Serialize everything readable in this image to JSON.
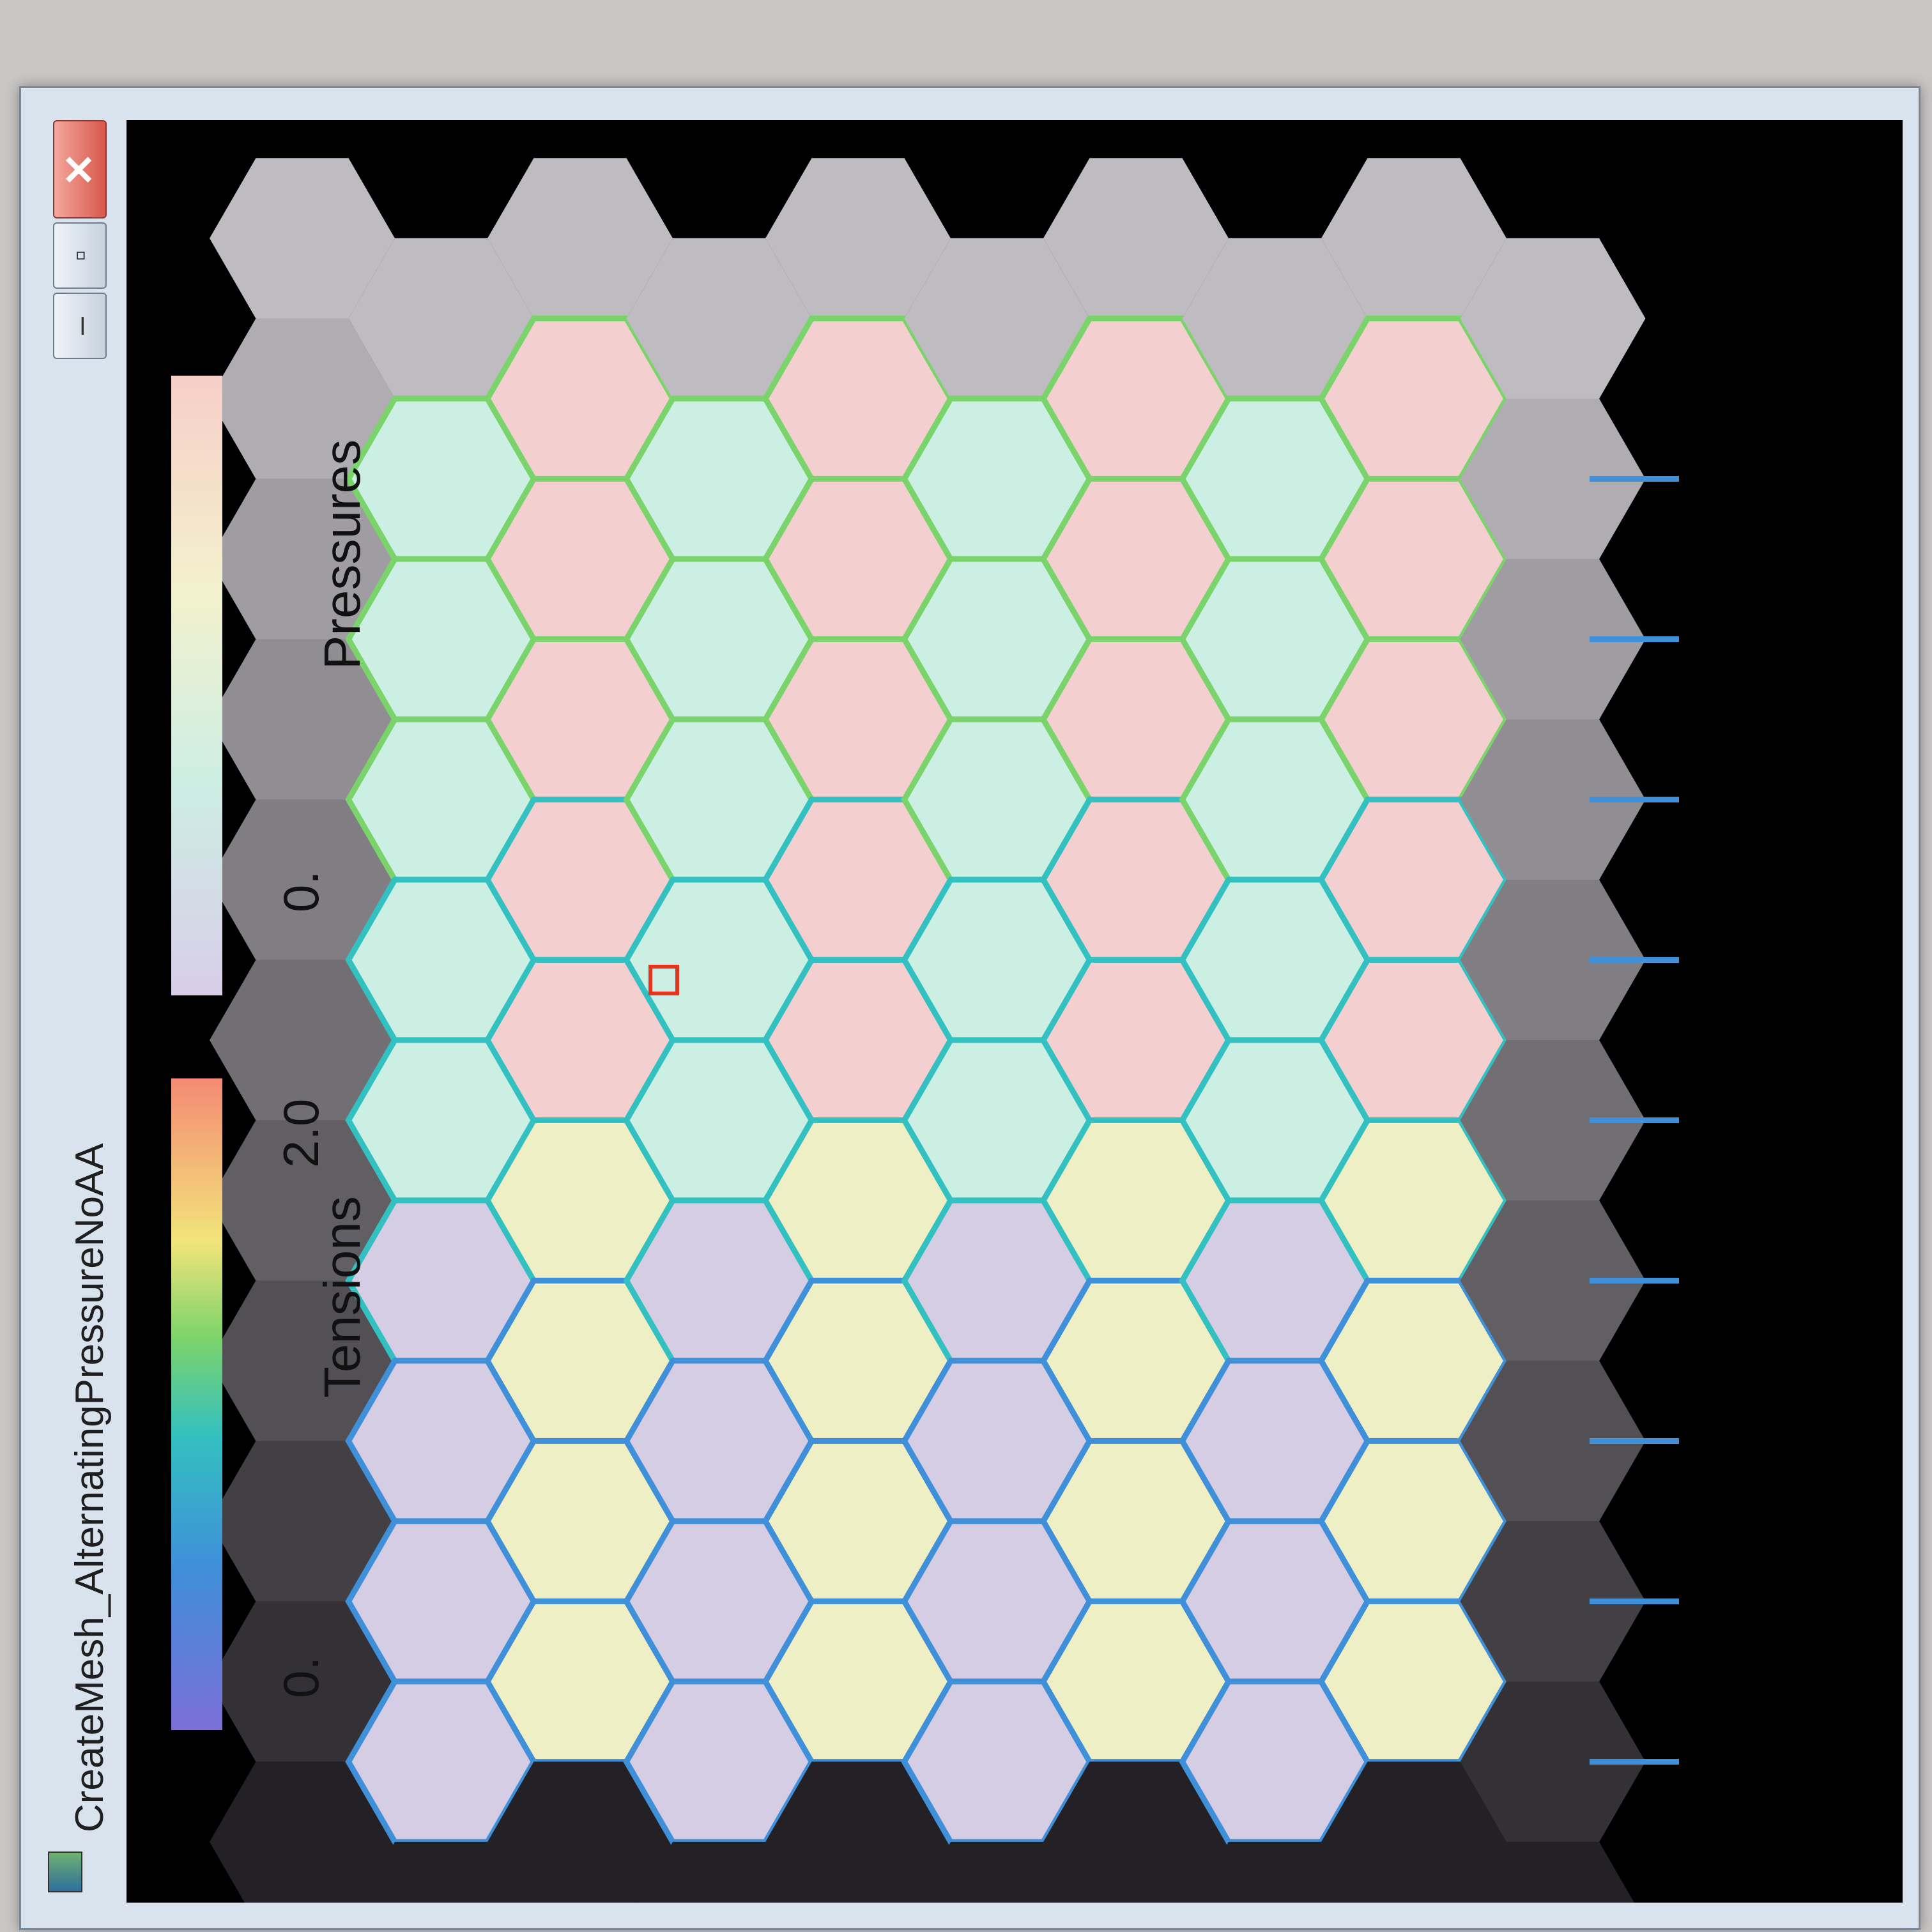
{
  "window": {
    "title": "CreateMesh_AlternatingPressureNoAA",
    "buttons": {
      "minimize": "–",
      "maximize": "▫",
      "close": "✕"
    }
  },
  "legend": {
    "tensions_label": "Tensions",
    "pressures_label": "Pressures",
    "range_labels": [
      "0.",
      "2.0",
      "0."
    ]
  },
  "mesh": {
    "rows": 11,
    "columns": 10,
    "pressure_pattern": "alternating",
    "fill_colors": {
      "boundary": "#bbb9bd",
      "high_pressure": "#f3d0cf",
      "low_pressure": "#ccefe3",
      "medium_pressure": "#efefc6",
      "lowest_pressure": "#d4cde3"
    },
    "edge_colors": {
      "low_tension": "#3f8fd9",
      "mid_tension": "#33c0c0",
      "high_tension": "#7bd36b"
    }
  },
  "cursor": {
    "marker": "red-square"
  }
}
